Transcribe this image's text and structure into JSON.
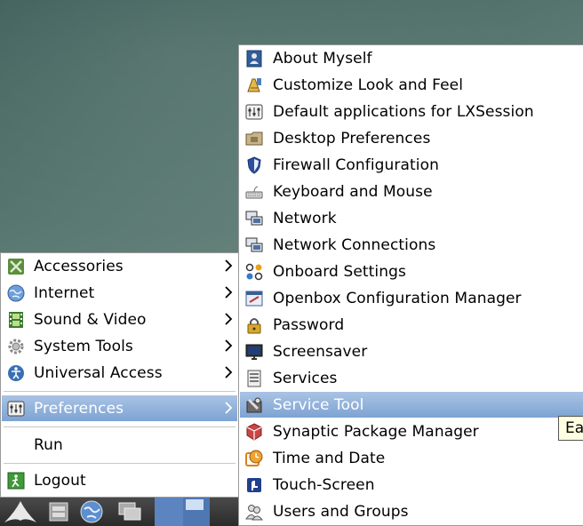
{
  "main_menu": {
    "items": [
      {
        "label": "Accessories",
        "icon": "accessories-icon",
        "has_submenu": true
      },
      {
        "label": "Internet",
        "icon": "internet-globe-icon",
        "has_submenu": true
      },
      {
        "label": "Sound & Video",
        "icon": "film-strip-icon",
        "has_submenu": true
      },
      {
        "label": "System Tools",
        "icon": "gear-icon",
        "has_submenu": true
      },
      {
        "label": "Universal Access",
        "icon": "accessibility-icon",
        "has_submenu": true
      },
      {
        "label": "Preferences",
        "icon": "preferences-icon",
        "has_submenu": true,
        "selected": true
      },
      {
        "label": "Run",
        "icon": "none",
        "has_submenu": false
      },
      {
        "label": "Logout",
        "icon": "logout-icon",
        "has_submenu": false
      }
    ]
  },
  "preferences_menu": {
    "items": [
      {
        "label": "About Myself",
        "icon": "user-card-icon"
      },
      {
        "label": "Customize Look and Feel",
        "icon": "paint-icon"
      },
      {
        "label": "Default applications for LXSession",
        "icon": "preferences-icon"
      },
      {
        "label": "Desktop Preferences",
        "icon": "desktop-folder-icon"
      },
      {
        "label": "Firewall Configuration",
        "icon": "shield-icon"
      },
      {
        "label": "Keyboard and Mouse",
        "icon": "keyboard-icon"
      },
      {
        "label": "Network",
        "icon": "network-icon"
      },
      {
        "label": "Network Connections",
        "icon": "network-icon"
      },
      {
        "label": "Onboard Settings",
        "icon": "onboard-dots-icon"
      },
      {
        "label": "Openbox Configuration Manager",
        "icon": "openbox-icon"
      },
      {
        "label": "Password",
        "icon": "lock-icon"
      },
      {
        "label": "Screensaver",
        "icon": "monitor-icon"
      },
      {
        "label": "Services",
        "icon": "services-icon"
      },
      {
        "label": "Service Tool",
        "icon": "service-tool-icon",
        "selected": true
      },
      {
        "label": "Synaptic Package Manager",
        "icon": "synaptic-icon"
      },
      {
        "label": "Time and Date",
        "icon": "clock-icon"
      },
      {
        "label": "Touch-Screen",
        "icon": "touch-screen-icon"
      },
      {
        "label": "Users and Groups",
        "icon": "users-icon"
      }
    ]
  },
  "tooltip": {
    "text": "Ea"
  },
  "taskbar": {
    "items": [
      "start-menu-icon",
      "file-manager-icon",
      "web-browser-icon",
      "show-desktop-icon",
      "workspace-1",
      "workspace-2"
    ]
  },
  "colors": {
    "selected_top": "#a9c3e4",
    "selected_bottom": "#7ea3d3",
    "menu_bg": "#ffffff",
    "taskbar": "#2b2b2b"
  }
}
